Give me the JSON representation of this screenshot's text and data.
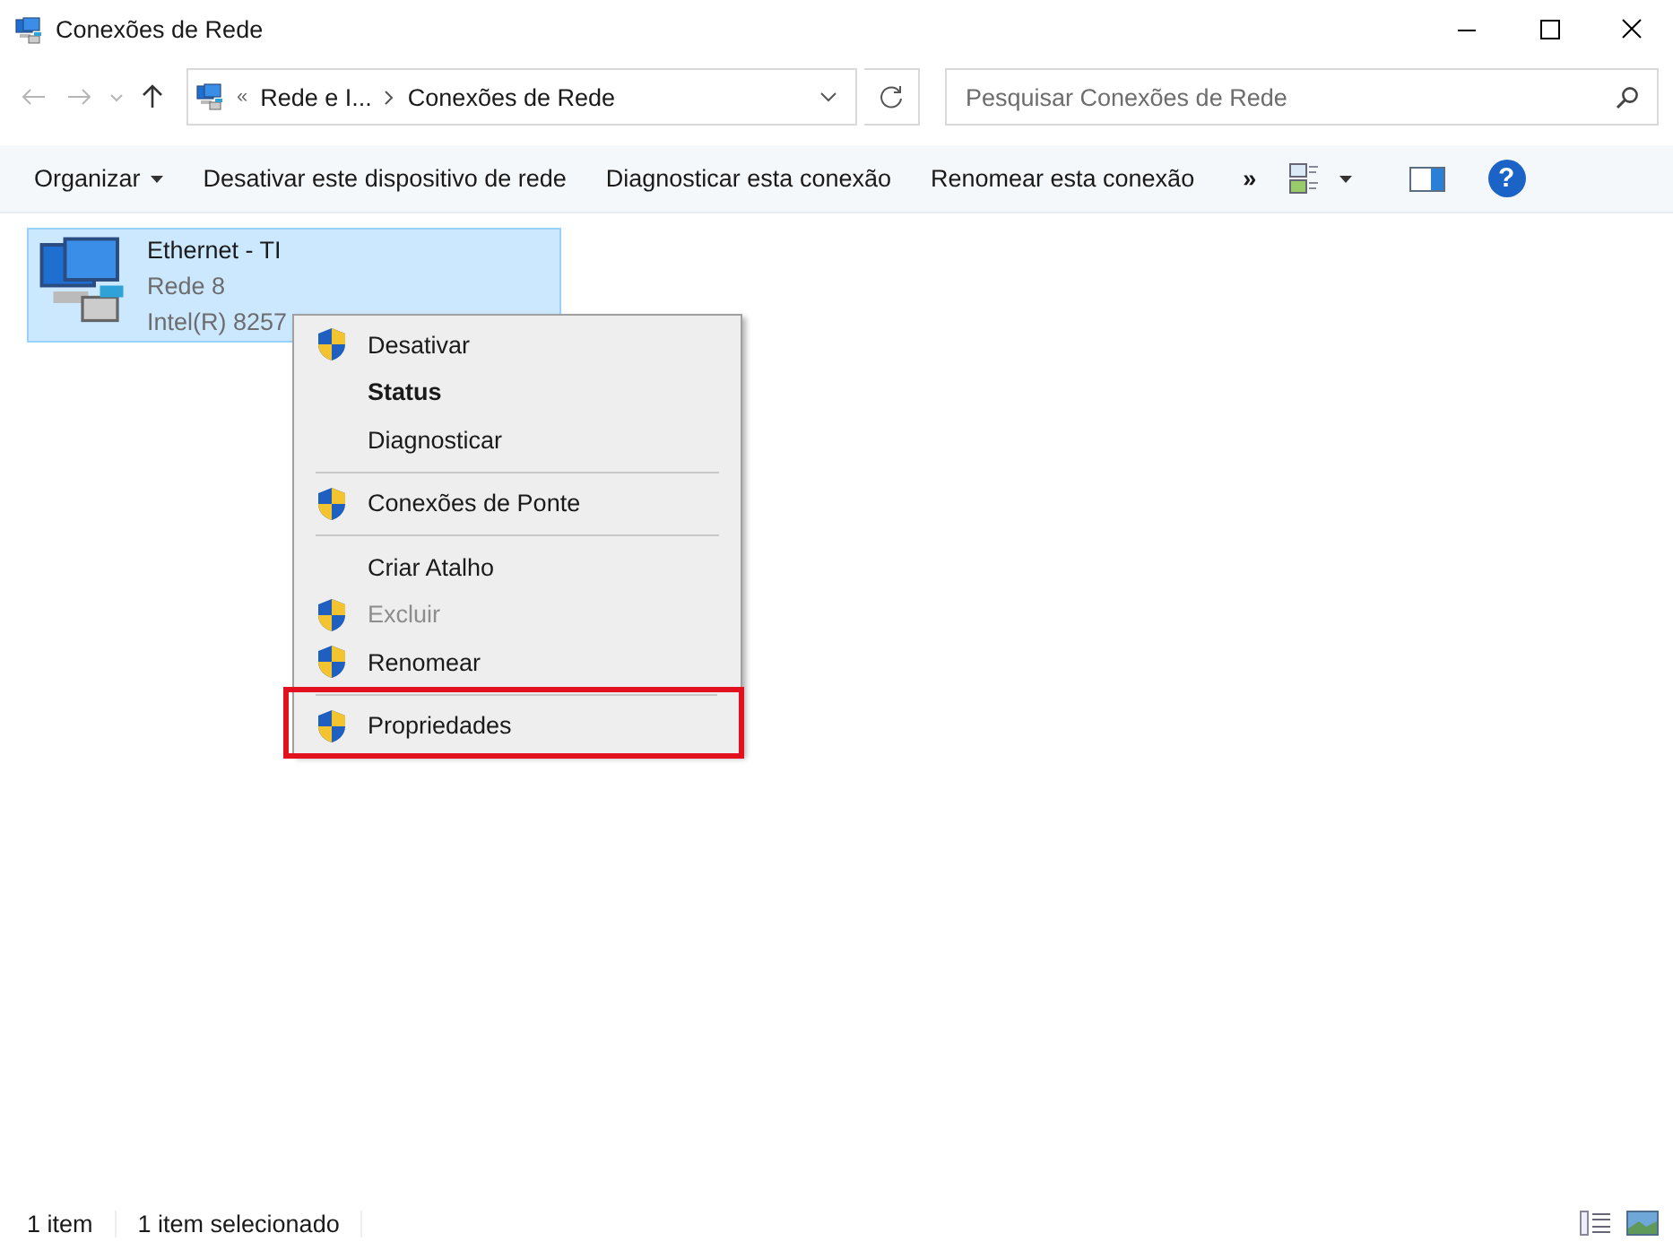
{
  "window": {
    "title": "Conexões de Rede"
  },
  "address": {
    "overflow": "«",
    "crumbs": [
      "Rede e I...",
      "Conexões de Rede"
    ]
  },
  "search": {
    "placeholder": "Pesquisar Conexões de Rede"
  },
  "toolbar": {
    "items": [
      {
        "label": "Organizar",
        "dropdown": true
      },
      {
        "label": "Desativar este dispositivo de rede",
        "dropdown": false
      },
      {
        "label": "Diagnosticar esta conexão",
        "dropdown": false
      },
      {
        "label": "Renomear esta conexão",
        "dropdown": false
      }
    ],
    "more": "»",
    "help": "?"
  },
  "connections": [
    {
      "name": "Ethernet - TI",
      "network": "Rede 8",
      "adapter": "Intel(R) 8257",
      "selected": true
    }
  ],
  "context_menu": {
    "items": [
      {
        "label": "Desativar",
        "shield": true,
        "bold": false,
        "disabled": false,
        "separator_before": false,
        "annotated": false
      },
      {
        "label": "Status",
        "shield": false,
        "bold": true,
        "disabled": false,
        "separator_before": false,
        "annotated": false
      },
      {
        "label": "Diagnosticar",
        "shield": false,
        "bold": false,
        "disabled": false,
        "separator_before": false,
        "annotated": false
      },
      {
        "label": "Conexões de Ponte",
        "shield": true,
        "bold": false,
        "disabled": false,
        "separator_before": true,
        "annotated": false
      },
      {
        "label": "Criar Atalho",
        "shield": false,
        "bold": false,
        "disabled": false,
        "separator_before": true,
        "annotated": false
      },
      {
        "label": "Excluir",
        "shield": true,
        "bold": false,
        "disabled": true,
        "separator_before": false,
        "annotated": false
      },
      {
        "label": "Renomear",
        "shield": true,
        "bold": false,
        "disabled": false,
        "separator_before": false,
        "annotated": false
      },
      {
        "label": "Propriedades",
        "shield": true,
        "bold": false,
        "disabled": false,
        "separator_before": true,
        "annotated": true
      }
    ]
  },
  "status_bar": {
    "items": [
      "1 item",
      "1 item selecionado"
    ]
  }
}
